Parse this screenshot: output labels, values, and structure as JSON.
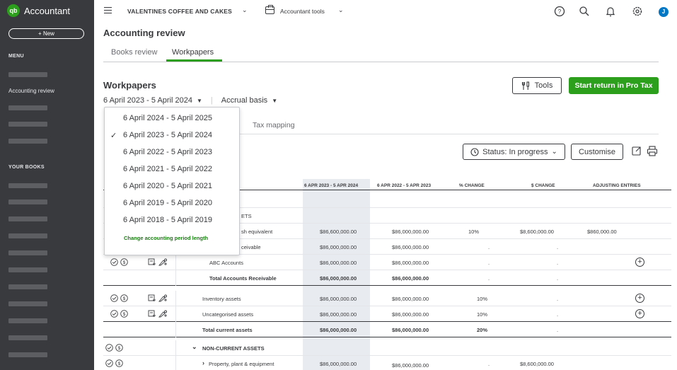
{
  "app": {
    "brand_name": "Accountant",
    "brand_logo_text": "qb",
    "accent_color": "#2ca01c",
    "sidebar_color": "#393a3d"
  },
  "sidebar": {
    "new_label": "+ New",
    "menu_heading": "MENU",
    "active_item": "Accounting review",
    "books_heading": "YOUR BOOKS"
  },
  "topbar": {
    "company_name": "VALENTINES COFFEE AND CAKES",
    "tools_label": "Accountant tools",
    "avatar_initial": "J",
    "icons": [
      "help-icon",
      "search-icon",
      "bell-icon",
      "gear-icon"
    ]
  },
  "page": {
    "title": "Accounting review",
    "tabs": [
      {
        "label": "Books review",
        "active": false
      },
      {
        "label": "Workpapers",
        "active": true
      }
    ]
  },
  "workpapers": {
    "title": "Workpapers",
    "period": "6 April 2023 - 5 April 2024",
    "basis": "Accrual basis",
    "tools_label": "Tools",
    "start_return_label": "Start return in Pro Tax",
    "tax_mapping_label": "Tax mapping",
    "status_label": "Status: In progress",
    "customise_label": "Customise"
  },
  "period_dropdown": {
    "options": [
      {
        "label": "6 April 2024 - 5 April 2025",
        "selected": false
      },
      {
        "label": "6 April 2023 - 5 April 2024",
        "selected": true
      },
      {
        "label": "6 April 2022 - 5 April 2023",
        "selected": false
      },
      {
        "label": "6 April 2021 - 5 April 2022",
        "selected": false
      },
      {
        "label": "6 April 2020 - 5 April 2021",
        "selected": false
      },
      {
        "label": "6 April 2019 - 5 April 2020",
        "selected": false
      },
      {
        "label": "6 April 2018 - 5 April 2019",
        "selected": false
      }
    ],
    "check_mark": "✓",
    "change_length_link": "Change accounting period length"
  },
  "table": {
    "headers": {
      "current": "6 APR 2023 - 5 APR 2024",
      "prior": "6 APR 2022 - 5 APR 2023",
      "pct_change": "% CHANGE",
      "dollar_change": "$ CHANGE",
      "adjusting": "ADJUSTING ENTRIES"
    },
    "rows": [
      {
        "label": "ETS",
        "current": "",
        "prior": "",
        "pct": "",
        "change": "",
        "adj": ""
      },
      {
        "label": "sh equivalent",
        "current": "$86,600,000.00",
        "prior": "$86,000,000.00",
        "pct": "10%",
        "change": "$8,600,000.00",
        "adj": "$860,000.00"
      },
      {
        "label": "ceivable",
        "current": "$86,000,000.00",
        "prior": "$86,000,000.00",
        "pct": ".",
        "change": ".",
        "adj": ""
      },
      {
        "label": "ABC Accounts",
        "current": "$86,000,000.00",
        "prior": "$86,000,000.00",
        "pct": ".",
        "change": ".",
        "adj": ""
      },
      {
        "label": "Total Accounts Receivable",
        "current": "$86,000,000.00",
        "prior": "$86,000,000.00",
        "pct": ".",
        "change": ".",
        "adj": ""
      },
      {
        "label": "Inventory assets",
        "current": "$86,000,000.00",
        "prior": "$86,000,000.00",
        "pct": "10%",
        "change": ".",
        "adj": ""
      },
      {
        "label": "Uncategorised assets",
        "current": "$86,000,000.00",
        "prior": "$86,000,000.00",
        "pct": "10%",
        "change": ".",
        "adj": ""
      },
      {
        "label": "Total current assets",
        "current": "$86,000,000.00",
        "prior": "$86,000,000.00",
        "pct": "20%",
        "change": ".",
        "adj": ""
      },
      {
        "label": "NON-CURRENT ASSETS",
        "current": "",
        "prior": "",
        "pct": "",
        "change": "",
        "adj": ""
      },
      {
        "label": "Property, plant & equipment",
        "current": "$86,000,000.00",
        "prior": "$86,000,000.00",
        "pct": ".",
        "change": "$8,600,000.00",
        "adj": ""
      }
    ],
    "add_symbol": "+",
    "expand_down": "⌄",
    "expand_right": "›"
  }
}
